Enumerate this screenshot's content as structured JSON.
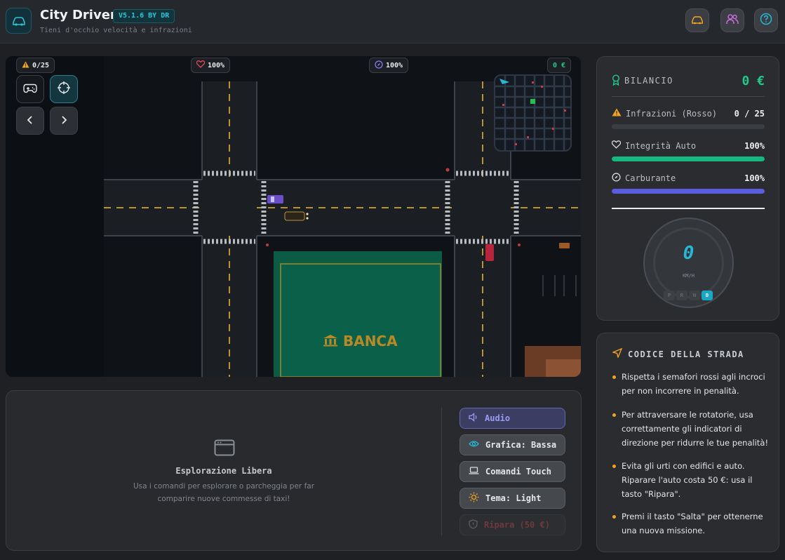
{
  "header": {
    "title": "City Driver",
    "version": "V5.1.6 BY DR",
    "subtitle": "Tieni d'occhio velocità e infrazioni"
  },
  "hud": {
    "infractions": "0/25",
    "health": "100%",
    "fuel": "100%",
    "money": "0 €"
  },
  "map": {
    "building_label": "BANCA"
  },
  "explore": {
    "title": "Esplorazione Libera",
    "description": "Usa i comandi per esplorare o parcheggia per far comparire nuove commesse di taxi!"
  },
  "settings": {
    "audio": "Audio",
    "graphics": "Grafica: Bassa",
    "controls": "Comandi Touch",
    "theme": "Tema: Light",
    "repair": "Ripara (50 €)"
  },
  "stats": {
    "balance_label": "BILANCIO",
    "balance_value": "0 €",
    "infractions_label": "Infrazioni (Rosso)",
    "infractions_value": "0 / 25",
    "infractions_level": 0,
    "integrity_label": "Integrità Auto",
    "integrity_value": "100%",
    "integrity_level": 1,
    "fuel_label": "Carburante",
    "fuel_value": "100%",
    "fuel_level": 1,
    "speed": "0",
    "speed_unit": "KM/H",
    "gears": [
      "P",
      "R",
      "N",
      "D"
    ],
    "active_gear": "D"
  },
  "rules": {
    "title": "CODICE DELLA STRADA",
    "items": [
      "Rispetta i semafori rossi agli incroci per non incorrere in penalità.",
      "Per attraversare le rotatorie, usa correttamente gli indicatori di direzione per ridurre le tue penalità!",
      "Evita gli urti con edifici e auto. Riparare l'auto costa 50 €: usa il tasto \"Ripara\".",
      "Premi il tasto \"Salta\" per ottenerne una nuova missione."
    ]
  },
  "colors": {
    "accent_cyan": "#28b8d6",
    "balance_green": "#22c98a",
    "integrity_bar": "#15b87f",
    "fuel_bar": "#5b5ce0",
    "warning_orange": "#f2a321",
    "heart_red": "#e5485b",
    "fuel_purple": "#8a7cf0",
    "header_pink": "#c86ad8"
  },
  "icons": {
    "logo": "car-icon",
    "header_buttons": [
      "car-icon",
      "users-icon",
      "help-icon"
    ],
    "controls": [
      "gamepad-icon",
      "crosshair-icon",
      "chevron-left-icon",
      "chevron-right-icon"
    ],
    "bank": "bank-icon"
  }
}
